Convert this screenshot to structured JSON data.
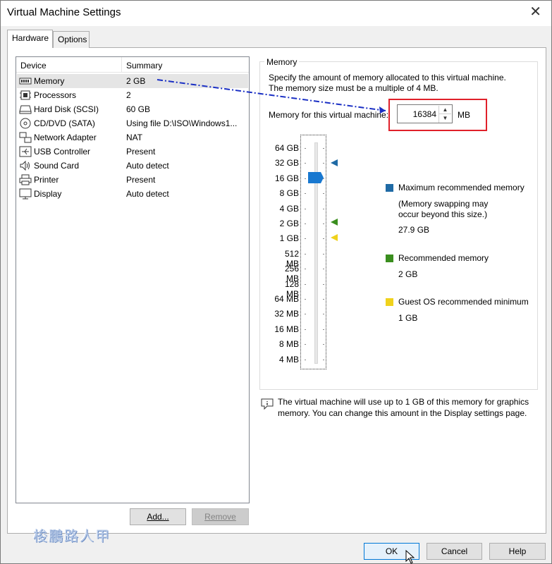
{
  "window": {
    "title": "Virtual Machine Settings",
    "close_glyph": "✕"
  },
  "tabs": [
    {
      "label": "Hardware"
    },
    {
      "label": "Options"
    }
  ],
  "device_list": {
    "col_device": "Device",
    "col_summary": "Summary",
    "rows": [
      {
        "icon": "memory-icon",
        "device": "Memory",
        "summary": "2 GB",
        "selected": true
      },
      {
        "icon": "processor-icon",
        "device": "Processors",
        "summary": "2"
      },
      {
        "icon": "hard-disk-icon",
        "device": "Hard Disk (SCSI)",
        "summary": "60 GB"
      },
      {
        "icon": "cd-dvd-icon",
        "device": "CD/DVD (SATA)",
        "summary": "Using file D:\\ISO\\Windows1..."
      },
      {
        "icon": "network-adapter-icon",
        "device": "Network Adapter",
        "summary": "NAT"
      },
      {
        "icon": "usb-icon",
        "device": "USB Controller",
        "summary": "Present"
      },
      {
        "icon": "sound-card-icon",
        "device": "Sound Card",
        "summary": "Auto detect"
      },
      {
        "icon": "printer-icon",
        "device": "Printer",
        "summary": "Present"
      },
      {
        "icon": "display-icon",
        "device": "Display",
        "summary": "Auto detect"
      }
    ],
    "add_button": "Add...",
    "remove_button": "Remove"
  },
  "memory": {
    "group_title": "Memory",
    "description_line1": "Specify the amount of memory allocated to this virtual machine.",
    "description_line2": "The memory size must be a multiple of 4 MB.",
    "field_label": "Memory for this virtual machine:",
    "value": "16384",
    "unit": "MB",
    "slider_ticks": [
      "64 GB",
      "32 GB",
      "16 GB",
      "8 GB",
      "4 GB",
      "2 GB",
      "1 GB",
      "512 MB",
      "256 MB",
      "128 MB",
      "64 MB",
      "32 MB",
      "16 MB",
      "8 MB",
      "4 MB"
    ],
    "slider_selected": "16 GB",
    "legend": {
      "max_label": "Maximum recommended memory",
      "max_note_line1": "(Memory swapping may",
      "max_note_line2": "occur beyond this size.)",
      "max_value": "27.9 GB",
      "rec_label": "Recommended memory",
      "rec_value": "2 GB",
      "min_label": "Guest OS recommended minimum",
      "min_value": "1 GB"
    },
    "info_line1": "The virtual machine will use up to 1 GB of this memory for graphics",
    "info_line2": "memory. You can change this amount in the Display settings page."
  },
  "colors": {
    "max": "#1f6aa5",
    "recommended": "#3a8e1e",
    "minimum": "#f0d21c",
    "arrow": "#1a2fc4",
    "highlight": "#e0202a",
    "thumb": "#1878d0"
  },
  "footer": {
    "ok": "OK",
    "cancel": "Cancel",
    "help": "Help"
  },
  "watermark": "梭鵬路人甲"
}
